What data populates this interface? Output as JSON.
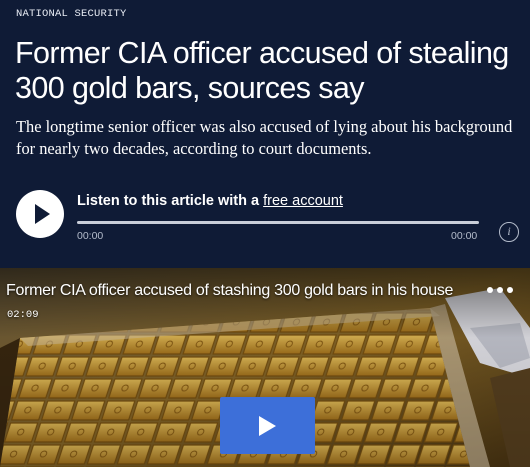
{
  "article": {
    "kicker": "NATIONAL SECURITY",
    "headline": "Former CIA officer accused of stealing 300 gold bars, sources say",
    "dek": "The longtime senior officer was also accused of lying about his background for nearly two decades, according to court documents."
  },
  "audio_player": {
    "listen_prefix": "Listen to this article with a ",
    "link_label": "free account",
    "time_current": "00:00",
    "time_total": "00:00",
    "progress": 0,
    "info_icon": "info-icon",
    "play_icon": "play-icon"
  },
  "video": {
    "title": "Former CIA officer accused of stashing 300 gold bars in his house",
    "duration": "02:09",
    "more_icon": "more-options-icon",
    "play_icon": "play-icon"
  },
  "colors": {
    "header_bg": "#0f1b36",
    "video_play_bg": "#3d6fd9",
    "gold": "#c9962f"
  }
}
